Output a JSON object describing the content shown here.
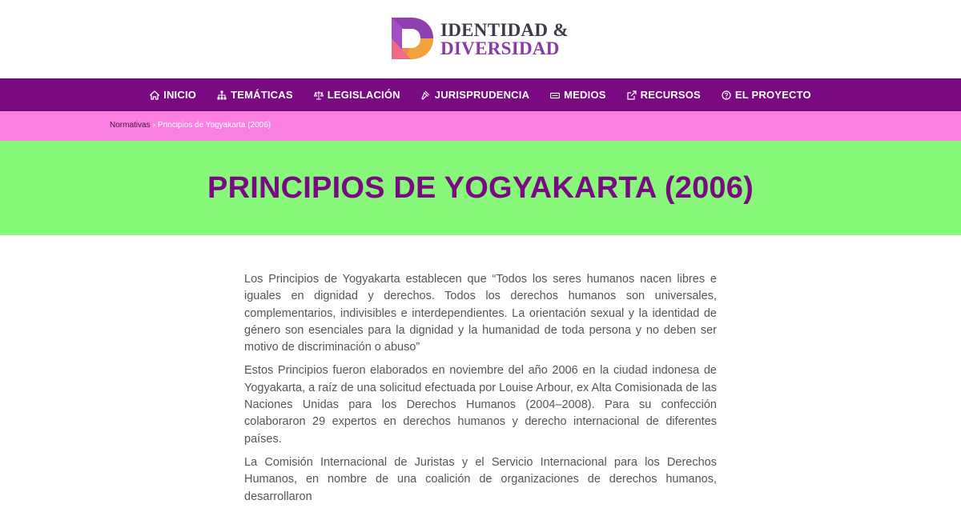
{
  "colors": {
    "purple": "#7a0a82",
    "pink": "#fb7fe0",
    "green": "#88f87a",
    "title": "#7a0a82",
    "text": "#555555",
    "logo_text_top": "#3b3b4a",
    "logo_text_bottom": "#8a3ca6"
  },
  "logo": {
    "line1": "IDENTIDAD &",
    "line2": "DIVERSIDAD"
  },
  "nav": {
    "items": [
      {
        "label": "INICIO",
        "icon": "home-icon"
      },
      {
        "label": "TEMÁTICAS",
        "icon": "sitemap-icon"
      },
      {
        "label": "LEGISLACIÓN",
        "icon": "balance-scale-icon"
      },
      {
        "label": "JURISPRUDENCIA",
        "icon": "gavel-icon"
      },
      {
        "label": "MEDIOS",
        "icon": "media-icon"
      },
      {
        "label": "RECURSOS",
        "icon": "external-link-icon"
      },
      {
        "label": "EL PROYECTO",
        "icon": "question-circle-icon"
      }
    ]
  },
  "breadcrumb": {
    "parent": "Normativas",
    "separator": "›",
    "current": "Principios de Yogyakarta (2006)"
  },
  "page": {
    "title": "PRINCIPIOS DE YOGYAKARTA (2006)"
  },
  "content": {
    "paragraphs": [
      "Los Principios de Yogyakarta establecen que “Todos los seres humanos nacen libres e iguales en dignidad y derechos. Todos los derechos humanos son universales, complementarios, indivisibles e interdependientes. La orientación sexual y la identidad de género son esenciales para la dignidad y la humanidad de toda persona y no deben ser motivo de discriminación o abuso”",
      "Estos Principios fueron elaborados en noviembre del año 2006 en la ciudad indonesa de Yogyakarta, a raíz de una solicitud efectuada por Louise Arbour, ex Alta Comisionada de las Naciones Unidas para los Derechos Humanos (2004–2008). Para su confección colaboraron 29 expertos en derechos humanos y derecho internacional de diferentes países.",
      "La Comisión Internacional de Juristas y el Servicio Internacional para los Derechos Humanos, en nombre de una coalición de organizaciones de derechos humanos, desarrollaron"
    ]
  }
}
